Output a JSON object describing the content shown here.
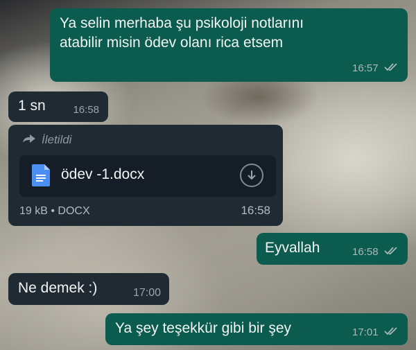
{
  "colors": {
    "outgoing_bubble": "#0b5b4e",
    "incoming_bubble": "#1f2a33",
    "text": "#f2f5f4",
    "read_ticks": "#a9bbb7"
  },
  "messages": {
    "m1": {
      "text": "Ya selin merhaba şu psikoloji notlarını\natabilir misin ödev olanı rica etsem",
      "time": "16:57",
      "status_icon": "double-check-icon"
    },
    "m2": {
      "text": "1 sn",
      "time": "16:58"
    },
    "m3": {
      "forwarded_label": "İletildi",
      "file_icon": "document-icon",
      "file_name": "ödev -1.docx",
      "file_info": "19 kB • DOCX",
      "time": "16:58",
      "download_icon": "download-icon"
    },
    "m4": {
      "text": "Eyvallah",
      "time": "16:58",
      "status_icon": "double-check-icon"
    },
    "m5": {
      "text": "Ne demek :)",
      "time": "17:00"
    },
    "m6": {
      "text": "Ya şey teşekkür gibi bir şey",
      "time": "17:01",
      "status_icon": "double-check-icon"
    }
  }
}
